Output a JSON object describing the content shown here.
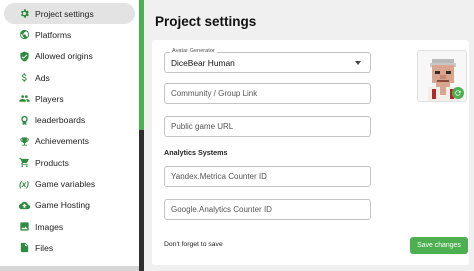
{
  "sidebar": {
    "items": [
      {
        "label": "Project settings",
        "icon": "gear-icon",
        "active": true
      },
      {
        "label": "Platforms",
        "icon": "globe-icon"
      },
      {
        "label": "Allowed origins",
        "icon": "shield-icon"
      },
      {
        "label": "Ads",
        "icon": "dollar-icon"
      },
      {
        "label": "Players",
        "icon": "people-icon"
      },
      {
        "label": "leaderboards",
        "icon": "medal-icon"
      },
      {
        "label": "Achievements",
        "icon": "trophy-icon"
      },
      {
        "label": "Products",
        "icon": "cart-icon"
      },
      {
        "label": "Game variables",
        "icon": "variable-icon",
        "glyph": "(x)"
      },
      {
        "label": "Game Hosting",
        "icon": "cloud-upload-icon"
      },
      {
        "label": "Images",
        "icon": "image-icon"
      },
      {
        "label": "Files",
        "icon": "file-icon"
      }
    ]
  },
  "main": {
    "title": "Project settings",
    "avatar_generator": {
      "legend": "Avatar Generator",
      "value": "DiceBear Human"
    },
    "community_link": {
      "placeholder": "Community / Group Link"
    },
    "public_game_url": {
      "placeholder": "Public game URL"
    },
    "analytics": {
      "title": "Analytics Systems",
      "yandex": {
        "placeholder": "Yandex.Metrica Counter ID"
      },
      "google": {
        "placeholder": "Google.Analytics Counter ID"
      }
    },
    "save_hint": "Don't forget to save",
    "save_button": "Save changes"
  },
  "colors": {
    "accent": "#4caf50",
    "sidebar_active": "#e3e3e3",
    "icon": "#2e8b3f"
  }
}
